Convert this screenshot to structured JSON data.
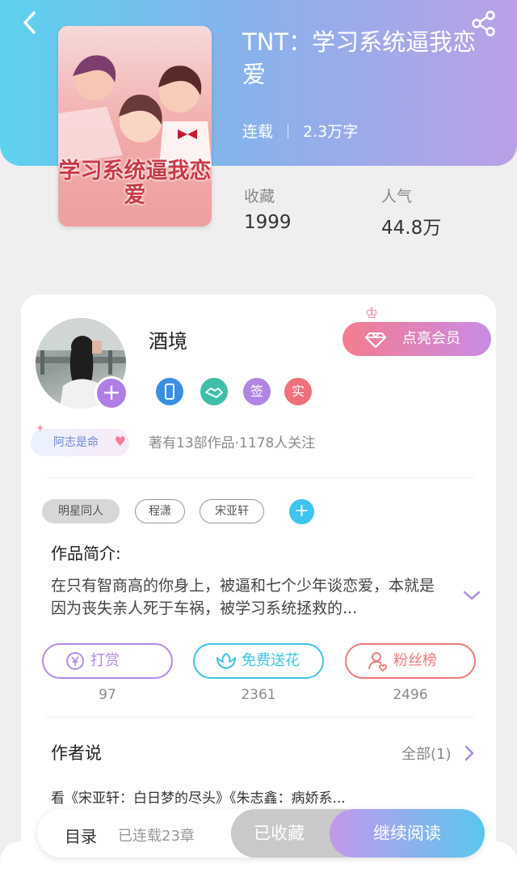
{
  "book": {
    "title": "TNT：学习系统逼我恋爱",
    "status": "连载",
    "word_count": "2.3万字",
    "cover_text": "学习系统逼我恋爱",
    "collect_label": "收藏",
    "collect_value": "1999",
    "popularity_label": "人气",
    "popularity_value": "44.8万"
  },
  "author": {
    "name": "酒境",
    "vip_label": "点亮会员",
    "fan_badge": "阿志是命",
    "badges": [
      {
        "name": "phone-badge-icon",
        "text": "",
        "color": "#3b8fe0"
      },
      {
        "name": "handshake-badge-icon",
        "text": "",
        "color": "#3fbfa8"
      },
      {
        "name": "sign-badge",
        "text": "签",
        "color": "#b085e4"
      },
      {
        "name": "verified-badge",
        "text": "实",
        "color": "#f0707c"
      }
    ],
    "works_info": "著有13部作品·1178人关注"
  },
  "tags": [
    "明星同人",
    "程潇",
    "宋亚轩"
  ],
  "intro": {
    "heading": "作品简介:",
    "text": "在只有智商高的你身上，被逼和七个少年谈恋爱，本就是因为丧失亲人死于车祸，被学习系统拯救的..."
  },
  "actions": [
    {
      "label": "打赏",
      "count": "97",
      "color": "#b48be6"
    },
    {
      "label": "免费送花",
      "count": "2361",
      "color": "#3fc3e0"
    },
    {
      "label": "粉丝榜",
      "count": "2496",
      "color": "#ee7a7a"
    }
  ],
  "author_say": {
    "heading": "作者说",
    "all_label": "全部(1)",
    "text": "看《宋亚轩：白日梦的尽头》《朱志鑫：病娇系..."
  },
  "bottom": {
    "toc_label": "目录",
    "chapters": "已连载23章",
    "favorited_label": "已收藏",
    "read_label": "继续阅读"
  },
  "colors": {
    "header_start": "#5cd2ee",
    "header_end": "#bba0e6",
    "accent_purple": "#b07fe6",
    "accent_blue": "#3fc3ef"
  }
}
